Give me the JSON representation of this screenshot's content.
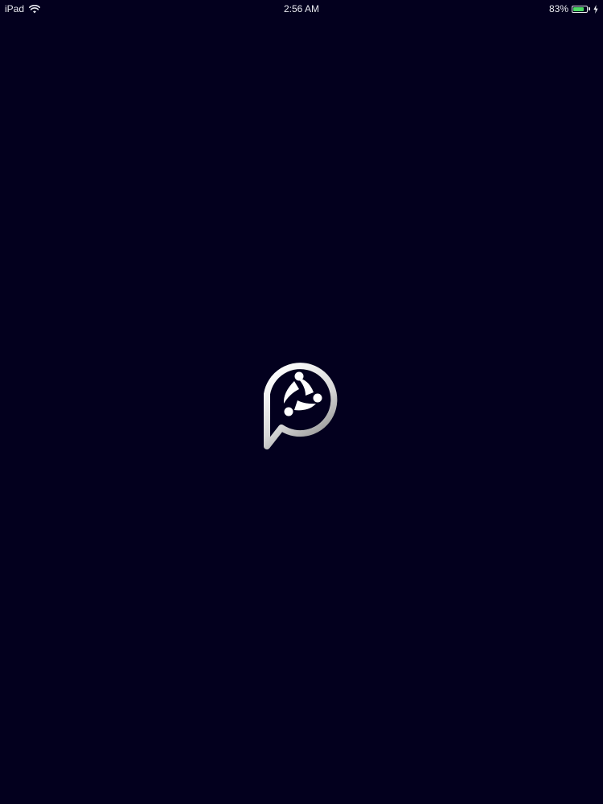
{
  "status_bar": {
    "device": "iPad",
    "time": "2:56 AM",
    "battery_percent": "83%",
    "battery_level": 0.83,
    "icons": {
      "wifi": "wifi-icon",
      "battery": "battery-icon",
      "charging": "charging-bolt-icon"
    }
  },
  "splash": {
    "logo_icon": "app-logo-icon"
  },
  "colors": {
    "background": "#03001e",
    "status_text": "#e9e9f0",
    "battery_fill": "#4cd964",
    "logo_light": "#ffffff",
    "logo_dark": "#8a8a8a"
  }
}
